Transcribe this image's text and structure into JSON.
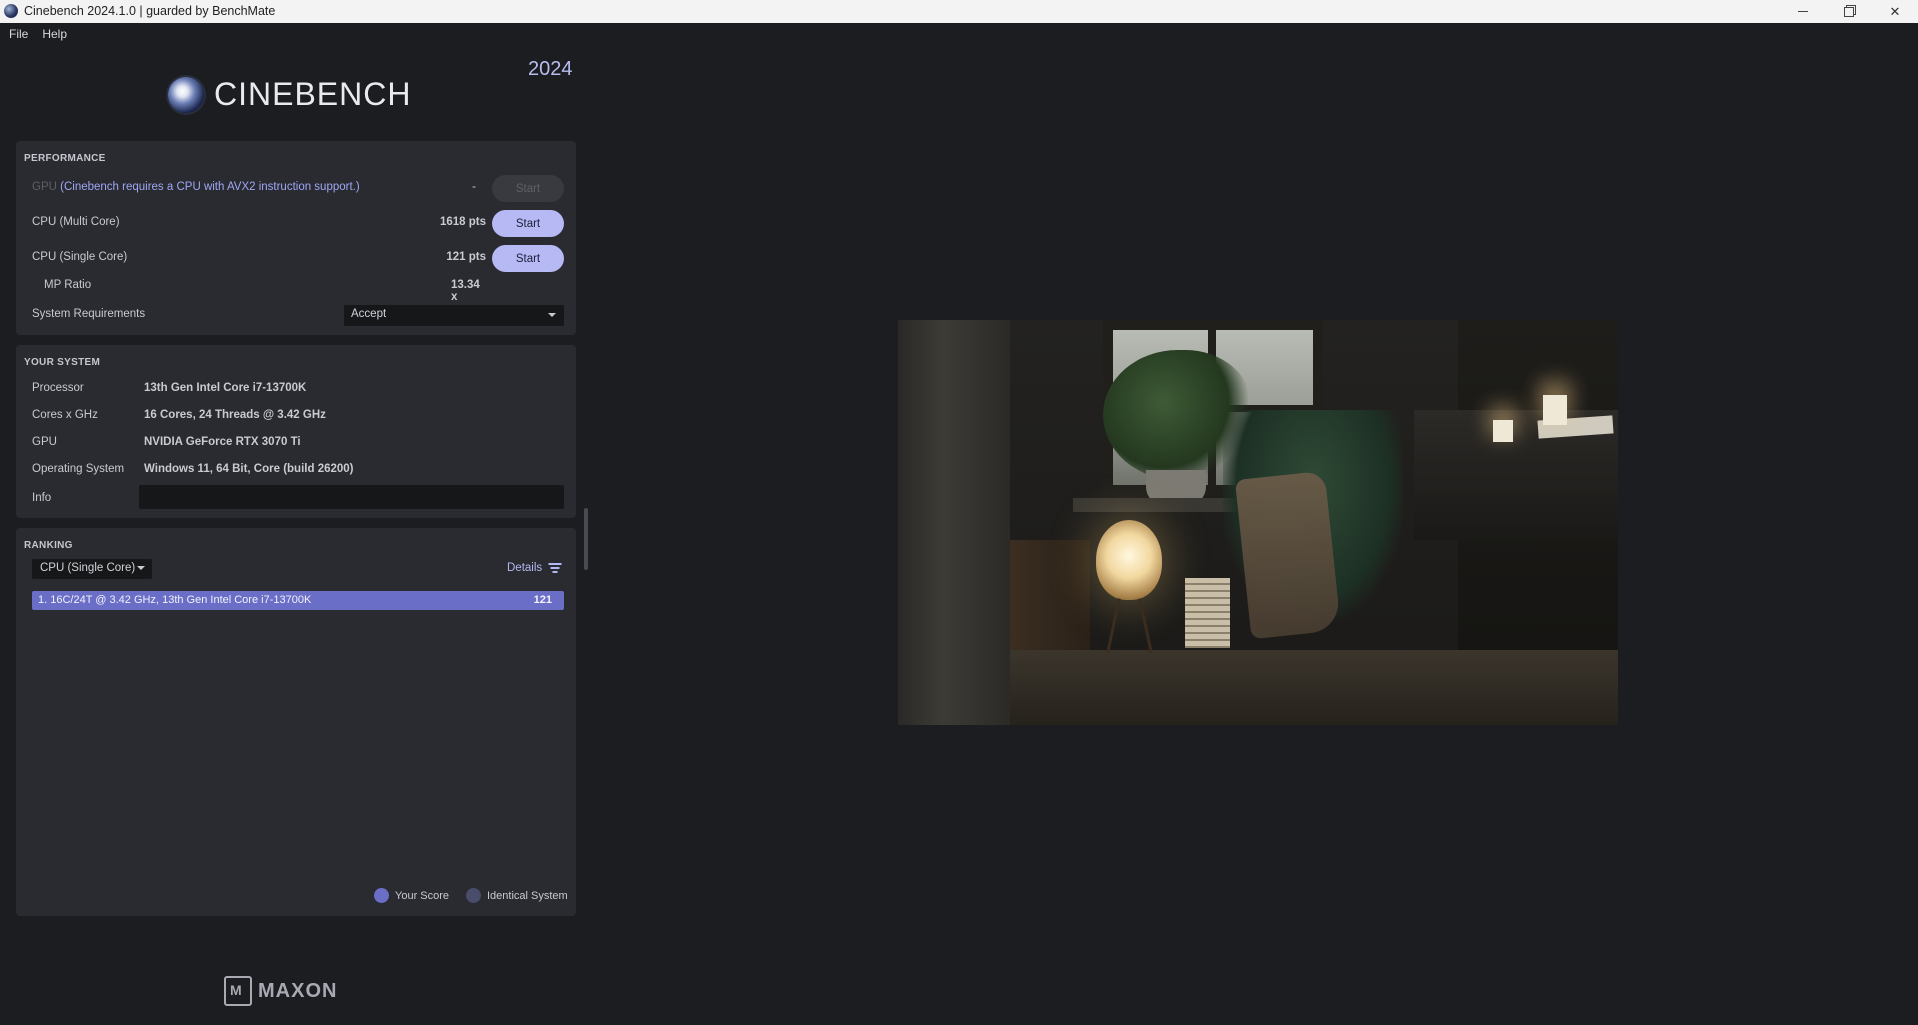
{
  "window": {
    "title": "Cinebench 2024.1.0 | guarded by BenchMate"
  },
  "menu": {
    "items": [
      "File",
      "Help"
    ]
  },
  "brand": {
    "logo_text": "CINEBENCH",
    "year": "2024",
    "footer_logo_text": "MAXON"
  },
  "performance": {
    "title": "PERFORMANCE",
    "gpu": {
      "label": "GPU",
      "note": "(Cinebench requires a CPU with AVX2 instruction support.)",
      "score": "-",
      "button": "Start"
    },
    "cpu_multi": {
      "label": "CPU (Multi Core)",
      "score": "1618 pts",
      "button": "Start"
    },
    "cpu_single": {
      "label": "CPU (Single Core)",
      "score": "121 pts",
      "button": "Start"
    },
    "mp_ratio": {
      "label": "MP Ratio",
      "value": "13.34 x"
    },
    "system_requirements": {
      "label": "System Requirements",
      "selected": "Accept"
    }
  },
  "your_system": {
    "title": "YOUR SYSTEM",
    "processor": {
      "label": "Processor",
      "value": "13th Gen Intel Core i7-13700K"
    },
    "cores": {
      "label": "Cores x GHz",
      "value": "16 Cores, 24 Threads @ 3.42 GHz"
    },
    "gpu": {
      "label": "GPU",
      "value": "NVIDIA GeForce RTX 3070 Ti"
    },
    "os": {
      "label": "Operating System",
      "value": "Windows 11, 64 Bit, Core (build 26200)"
    },
    "info": {
      "label": "Info",
      "value": ""
    }
  },
  "ranking": {
    "title": "RANKING",
    "selected_test": "CPU (Single Core)",
    "details_label": "Details",
    "rows": [
      {
        "name": "1. 16C/24T @ 3.42 GHz, 13th Gen Intel Core i7-13700K",
        "score": "121"
      }
    ],
    "legend": {
      "your_score": "Your Score",
      "identical_system": "Identical System"
    }
  },
  "colors": {
    "accent": "#b7b9f5",
    "rank_highlight": "#6b6ec7",
    "panel": "#2a2b30",
    "background": "#1c1d20"
  }
}
